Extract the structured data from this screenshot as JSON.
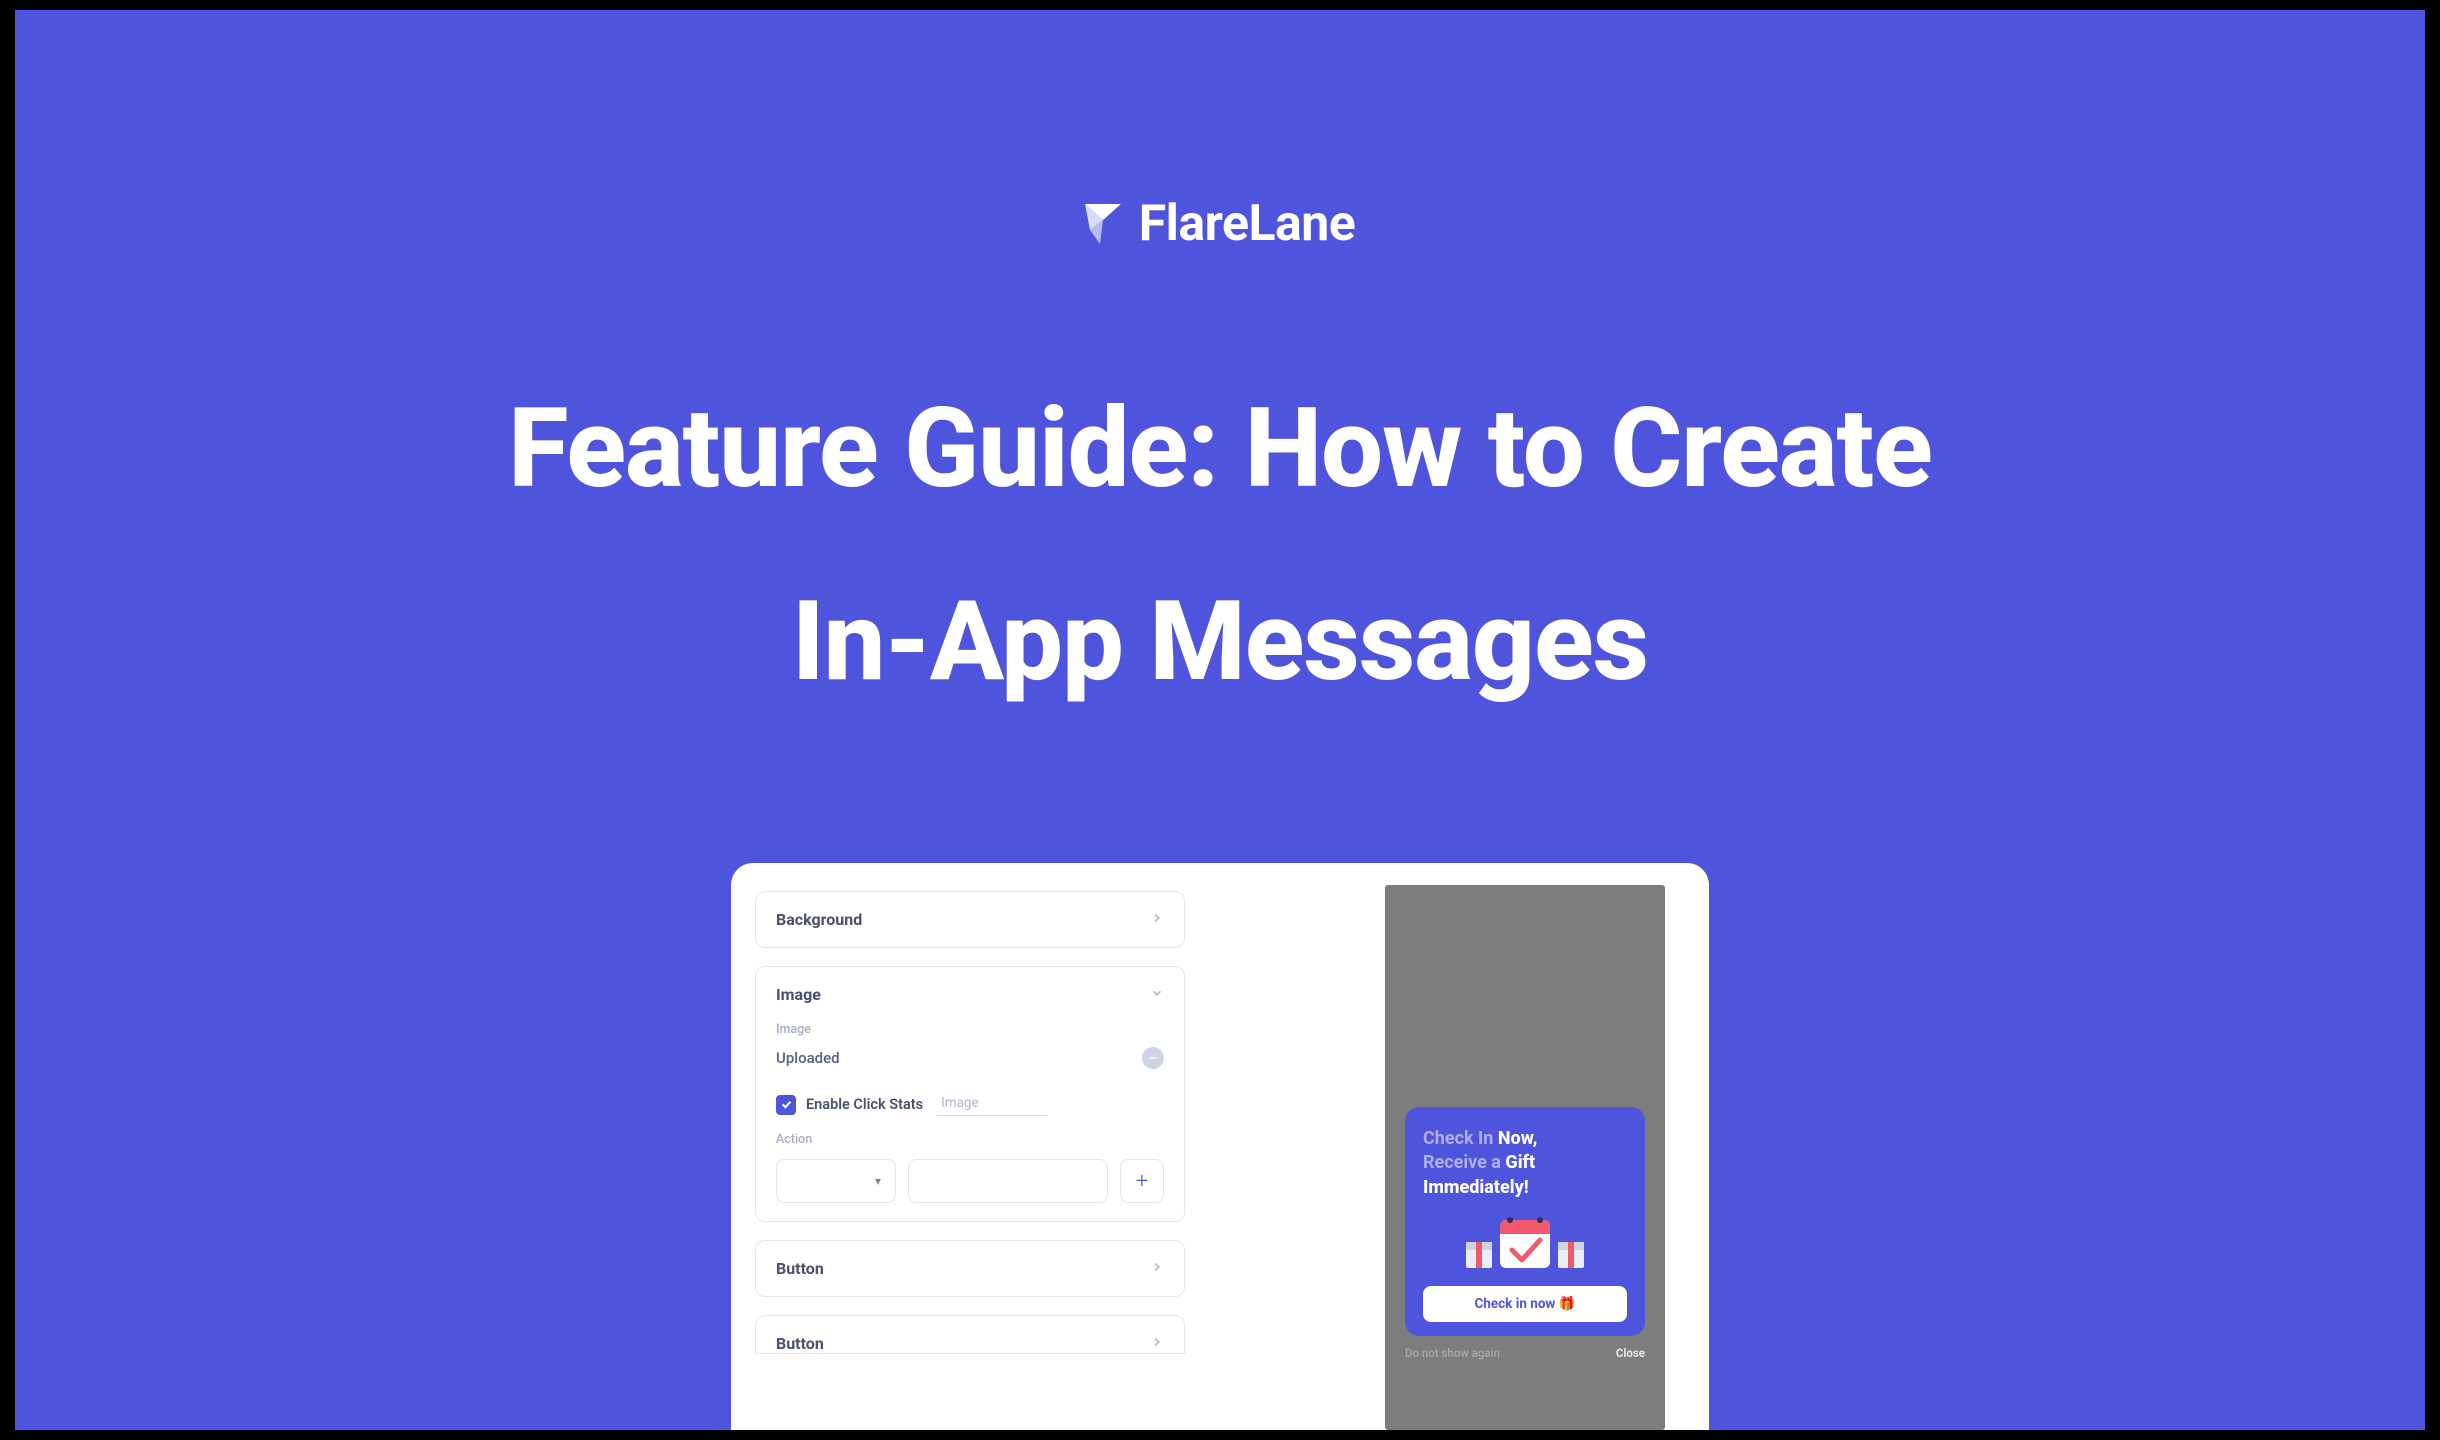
{
  "brand": {
    "name": "FlareLane"
  },
  "hero": {
    "title_line1": "Feature Guide: How to Create",
    "title_line2": "In-App Messages"
  },
  "form": {
    "background": {
      "title": "Background"
    },
    "image": {
      "title": "Image",
      "small_label": "Image",
      "uploaded_text": "Uploaded",
      "enable_click_label": "Enable Click Stats",
      "click_field_placeholder": "Image",
      "action_label": "Action",
      "select_caret": "▾"
    },
    "button1": {
      "title": "Button"
    },
    "button2": {
      "title": "Button"
    }
  },
  "preview": {
    "line1_pre": "Check In ",
    "line1_bold": "Now,",
    "line2_pre": "Receive a ",
    "line2_bold": "Gift",
    "line3_bold": "Immediately!",
    "cta": "Check in now 🎁",
    "foot_left": "Do not show again",
    "foot_right": "Close"
  }
}
